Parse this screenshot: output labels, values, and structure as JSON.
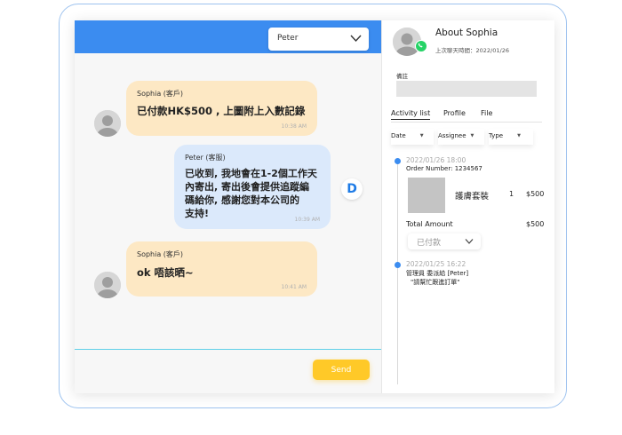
{
  "chat": {
    "contact_select": "Peter",
    "messages": [
      {
        "sender": "Sophia (客戶)",
        "text": "已付款HK$500 , 上圖附上入數記錄",
        "time": "10:38 AM"
      },
      {
        "sender": "Peter (客服)",
        "text": "已收到, 我地會在1-2個工作天\n內寄出, 寄出後會提供追蹤編\n碼給你, 感謝您對本公司的\n支持!",
        "time": "10:39 AM"
      },
      {
        "sender": "Sophia (客戶)",
        "text": "ok 唔該晒~",
        "time": "10:41 AM"
      }
    ],
    "agent_badge": "D",
    "send_label": "Send"
  },
  "info": {
    "title": "About Sophia",
    "last_chat": "上次聊天時間：2022/01/26",
    "note_label": "備註",
    "tabs": [
      "Activity list",
      "Profile",
      "File"
    ],
    "filters": [
      "Date",
      "Assignee",
      "Type"
    ],
    "activities": [
      {
        "timestamp": "2022/01/26 18:00",
        "order_number": "Order Number: 1234567",
        "product_name": "護膚套裝",
        "quantity": "1",
        "price": "$500",
        "total_label": "Total Amount",
        "total": "$500",
        "status": "已付款"
      },
      {
        "timestamp": "2022/01/25 16:22",
        "line1": "管理員 委派給 [Peter]",
        "line2": "\"請幫忙跟進訂單\""
      }
    ]
  },
  "colors": {
    "header_blue": "#3b8cf0",
    "customer_bubble": "#fde8c4",
    "agent_bubble": "#dbe9fb",
    "send_button": "#ffc928",
    "whatsapp_green": "#25d366"
  },
  "icons": [
    "chevron-down-icon",
    "user-avatar-icon",
    "whatsapp-icon",
    "timeline-dot-icon"
  ]
}
